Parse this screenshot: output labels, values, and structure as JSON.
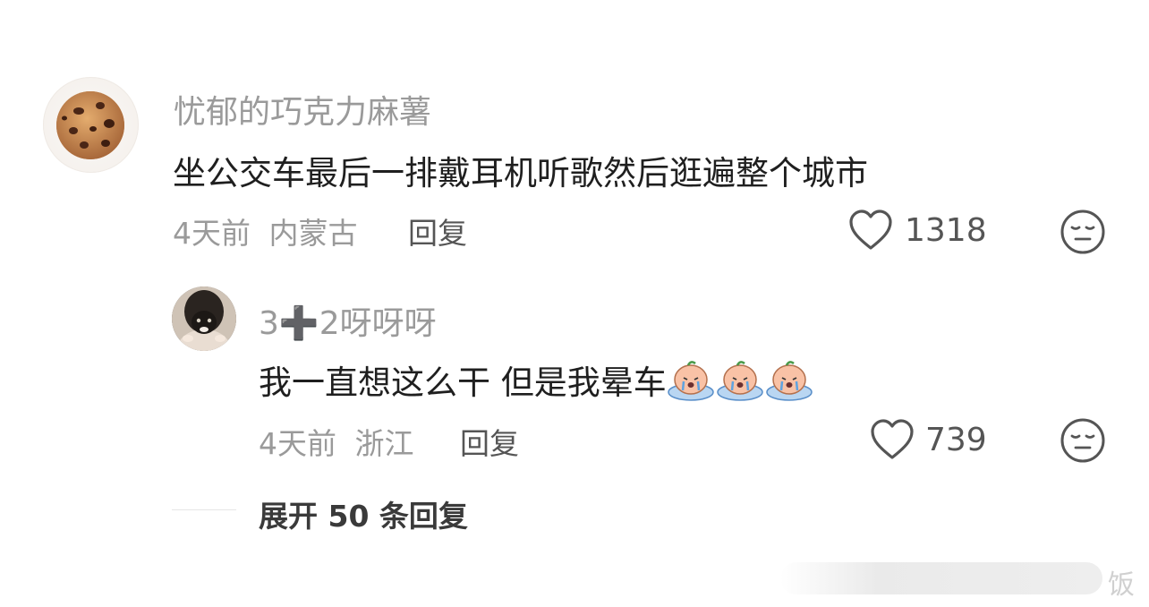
{
  "comment": {
    "username": "忧郁的巧克力麻薯",
    "text": "坐公交车最后一排戴耳机听歌然后逛遍整个城市",
    "time": "4天前",
    "location": "内蒙古",
    "reply_label": "回复",
    "likes": "1318"
  },
  "reply": {
    "username": "3➕2呀呀呀",
    "text": "我一直想这么干 但是我晕车",
    "time": "4天前",
    "location": "浙江",
    "reply_label": "回复",
    "likes": "739"
  },
  "expand": {
    "label": "展开 50 条回复"
  },
  "watermark": {
    "text": "饭"
  },
  "icons": {
    "like": "heart-outline-icon",
    "dislike": "meh-face-icon",
    "crying_emoji": "crying-sticker-icon"
  },
  "colors": {
    "meta_gray": "#9a9a9a",
    "text_dark": "#1f1f1f",
    "icon_gray": "#555555"
  }
}
